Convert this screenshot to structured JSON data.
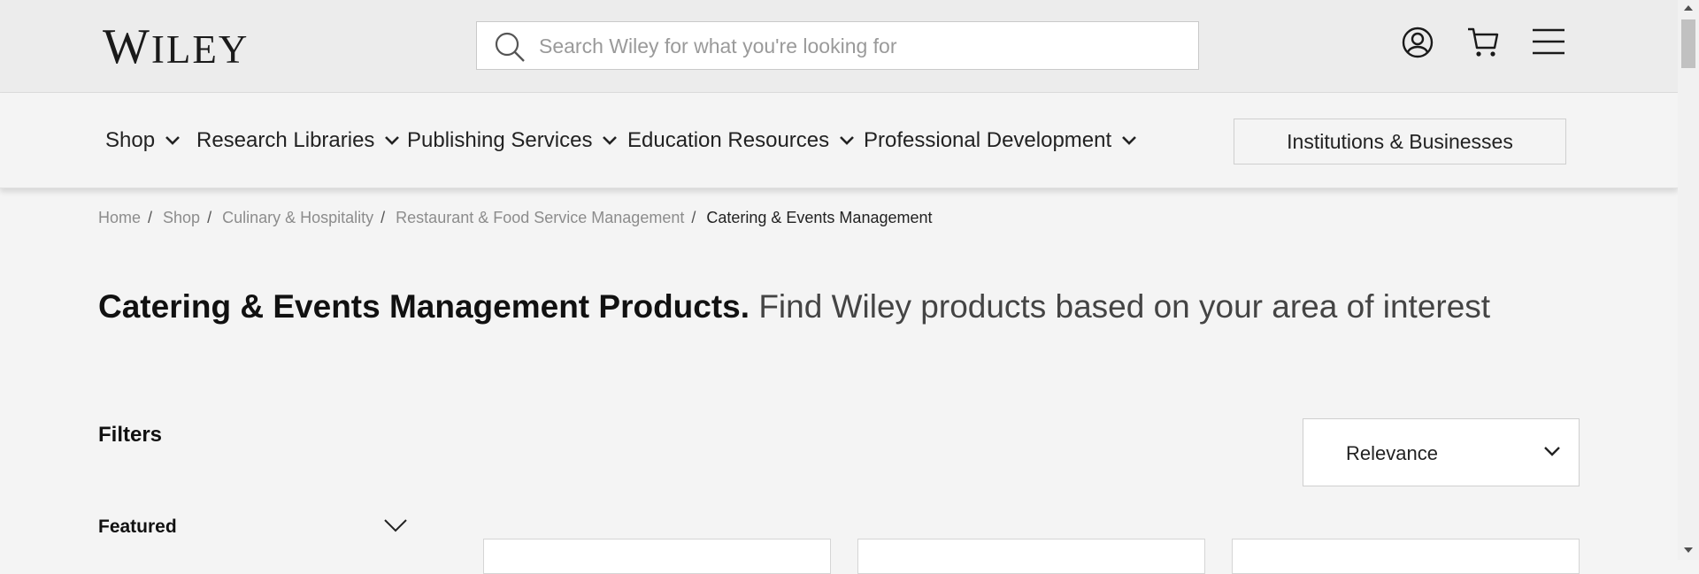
{
  "header": {
    "logo_text": "WILEY",
    "search_placeholder": "Search Wiley for what you're looking for",
    "icons": [
      "account-icon",
      "cart-icon",
      "menu-icon"
    ]
  },
  "nav": {
    "items": [
      {
        "label": "Shop"
      },
      {
        "label": "Research Libraries"
      },
      {
        "label": "Publishing Services"
      },
      {
        "label": "Education Resources"
      },
      {
        "label": "Professional Development"
      }
    ],
    "institutions_button": "Institutions & Businesses"
  },
  "breadcrumb": {
    "items": [
      "Home",
      "Shop",
      "Culinary & Hospitality",
      "Restaurant & Food Service Management"
    ],
    "current": "Catering & Events Management"
  },
  "heading": {
    "title": "Catering & Events Management Products.",
    "subtitle": "Find Wiley products based on your area of interest"
  },
  "filters": {
    "title": "Filters",
    "featured_label": "Featured"
  },
  "sort": {
    "selected": "Relevance"
  }
}
